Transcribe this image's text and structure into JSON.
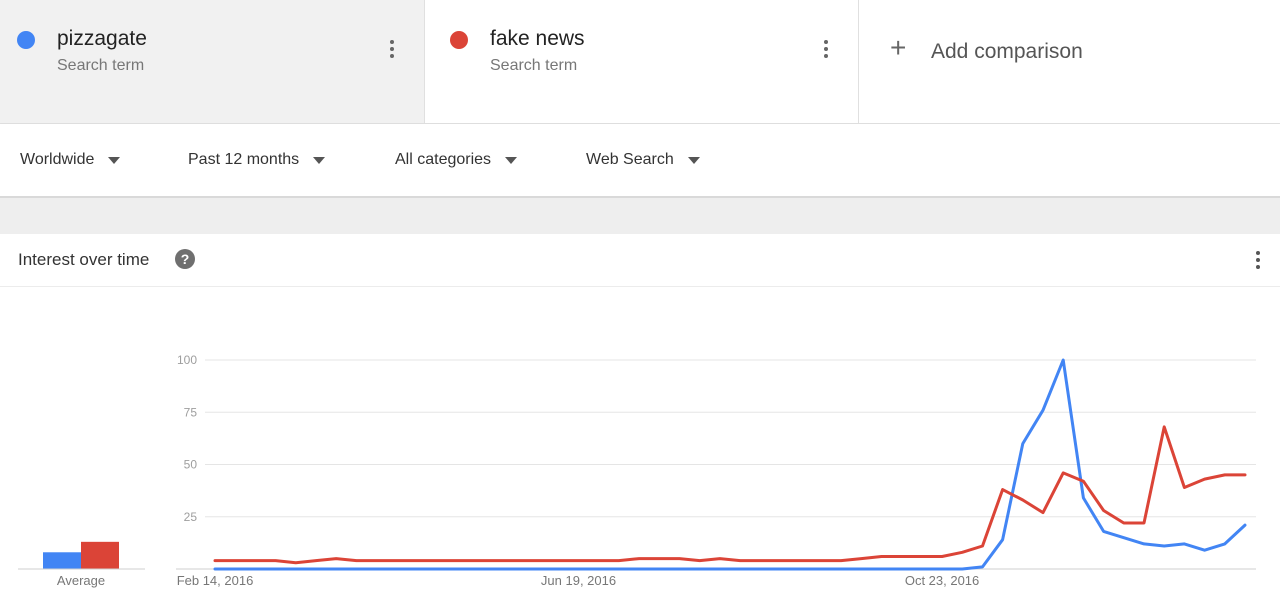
{
  "terms": [
    {
      "name": "pizzagate",
      "subtitle": "Search term",
      "color": "#4285f4"
    },
    {
      "name": "fake news",
      "subtitle": "Search term",
      "color": "#db4437"
    }
  ],
  "add_comparison": {
    "label": "Add comparison",
    "icon": "plus-icon"
  },
  "filters": {
    "region": "Worldwide",
    "time": "Past 12 months",
    "category": "All categories",
    "search_type": "Web Search"
  },
  "card": {
    "title": "Interest over time",
    "help_icon": "?"
  },
  "chart_data": {
    "type": "line",
    "ylim": [
      0,
      100
    ],
    "yticks": [
      25,
      50,
      75,
      100
    ],
    "x_labels": [
      "Feb 14, 2016",
      "Jun 19, 2016",
      "Oct 23, 2016"
    ],
    "x_label_indices": [
      0,
      18,
      36
    ],
    "num_points": 51,
    "series": [
      {
        "name": "pizzagate",
        "color": "#4285f4",
        "values": [
          0,
          0,
          0,
          0,
          0,
          0,
          0,
          0,
          0,
          0,
          0,
          0,
          0,
          0,
          0,
          0,
          0,
          0,
          0,
          0,
          0,
          0,
          0,
          0,
          0,
          0,
          0,
          0,
          0,
          0,
          0,
          0,
          0,
          0,
          0,
          0,
          0,
          0,
          1,
          14,
          60,
          76,
          100,
          34,
          18,
          15,
          12,
          11,
          12,
          9,
          12,
          21
        ]
      },
      {
        "name": "fake news",
        "color": "#db4437",
        "values": [
          4,
          4,
          4,
          4,
          3,
          4,
          5,
          4,
          4,
          4,
          4,
          4,
          4,
          4,
          4,
          4,
          4,
          4,
          4,
          4,
          4,
          5,
          5,
          5,
          4,
          5,
          4,
          4,
          4,
          4,
          4,
          4,
          5,
          6,
          6,
          6,
          6,
          8,
          11,
          38,
          33,
          27,
          46,
          42,
          28,
          22,
          22,
          68,
          39,
          43,
          45,
          45
        ]
      }
    ],
    "average": {
      "label": "Average",
      "values": [
        8,
        13
      ]
    }
  }
}
